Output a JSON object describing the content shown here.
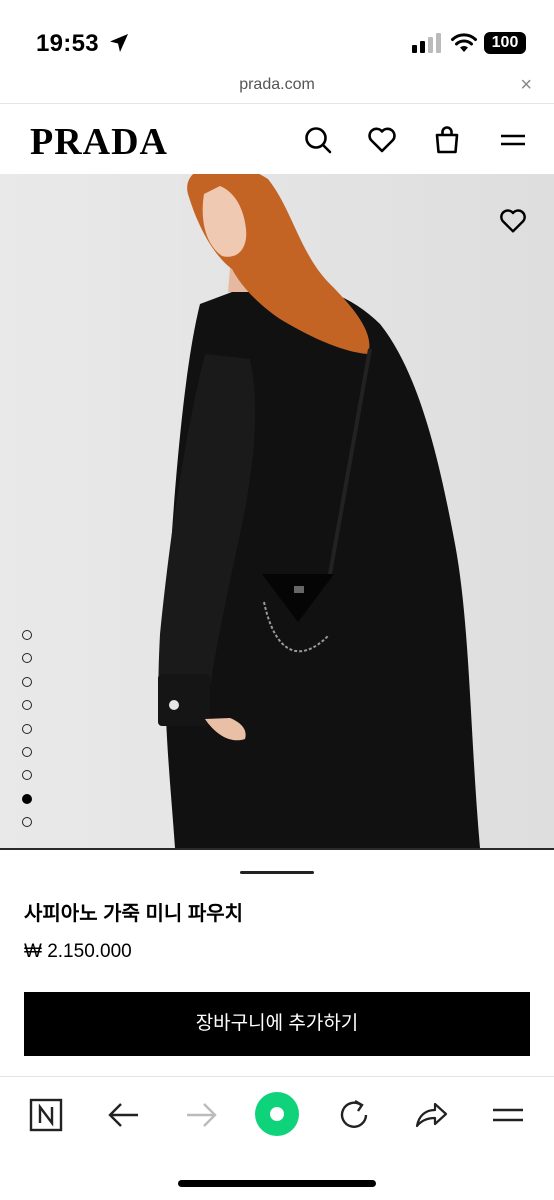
{
  "status": {
    "time": "19:53",
    "battery": "100"
  },
  "browser": {
    "url": "prada.com",
    "close_symbol": "×"
  },
  "header": {
    "logo": "PRADA"
  },
  "hero": {
    "slide_count": 9,
    "active_slide": 8
  },
  "product": {
    "name": "사피아노 가죽 미니 파우치",
    "price": "₩ 2.150.000",
    "add_to_cart": "장바구니에 추가하기"
  },
  "icons": {
    "header": [
      "search-icon",
      "heart-icon",
      "shopping-bag-icon",
      "menu-icon"
    ],
    "toolbar": [
      "n-tab-icon",
      "back-arrow-icon",
      "forward-arrow-icon",
      "green-home-icon",
      "reload-icon",
      "share-icon",
      "menu-icon"
    ]
  },
  "colors": {
    "accent_green": "#0ed37a",
    "button_bg": "#000000",
    "hero_bg": "#e6e6e6"
  }
}
